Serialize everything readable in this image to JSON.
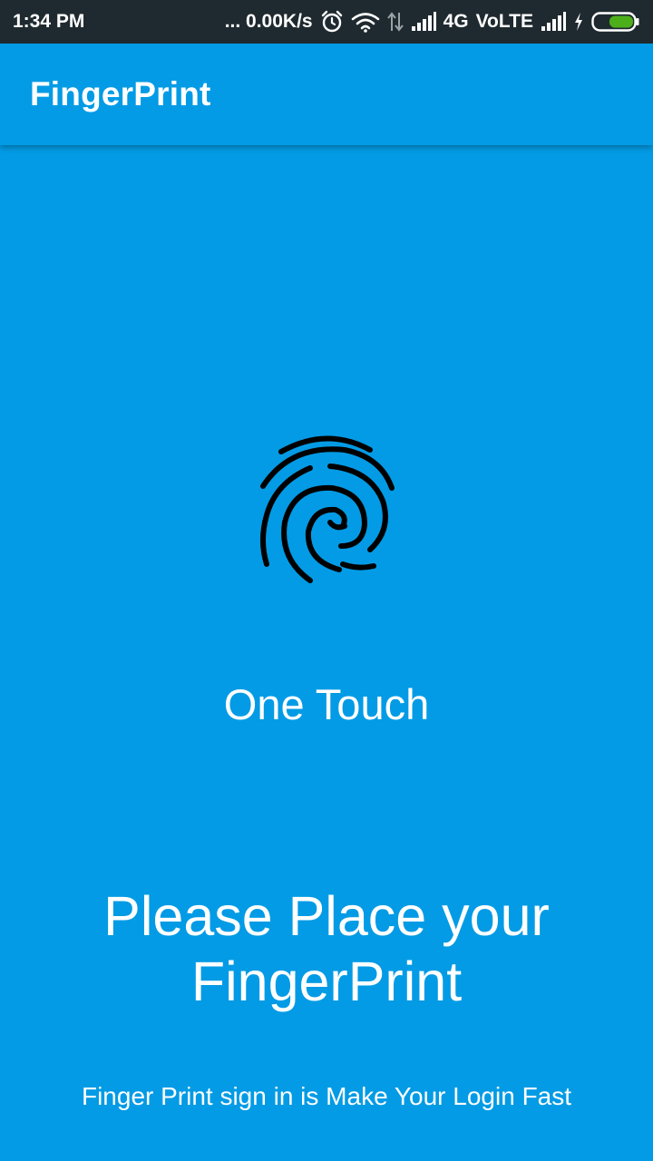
{
  "status_bar": {
    "time": "1:34 PM",
    "network_speed": "... 0.00K/s",
    "network_type": "4G",
    "volte": "VoLTE",
    "icons": [
      "alarm-icon",
      "wifi-icon",
      "data-arrows-icon",
      "signal-icon",
      "signal-icon",
      "charging-icon",
      "battery-icon"
    ]
  },
  "app_bar": {
    "title": "FingerPrint"
  },
  "main": {
    "icon": "fingerprint-icon",
    "label": "One Touch",
    "instruction": "Please Place your FingerPrint",
    "footer": "Finger Print sign in is Make Your Login Fast"
  },
  "colors": {
    "primary": "#039be5",
    "status_bar": "#1f2a30",
    "text": "#ffffff",
    "icon": "#000000",
    "battery_fill": "#4caf1a"
  }
}
